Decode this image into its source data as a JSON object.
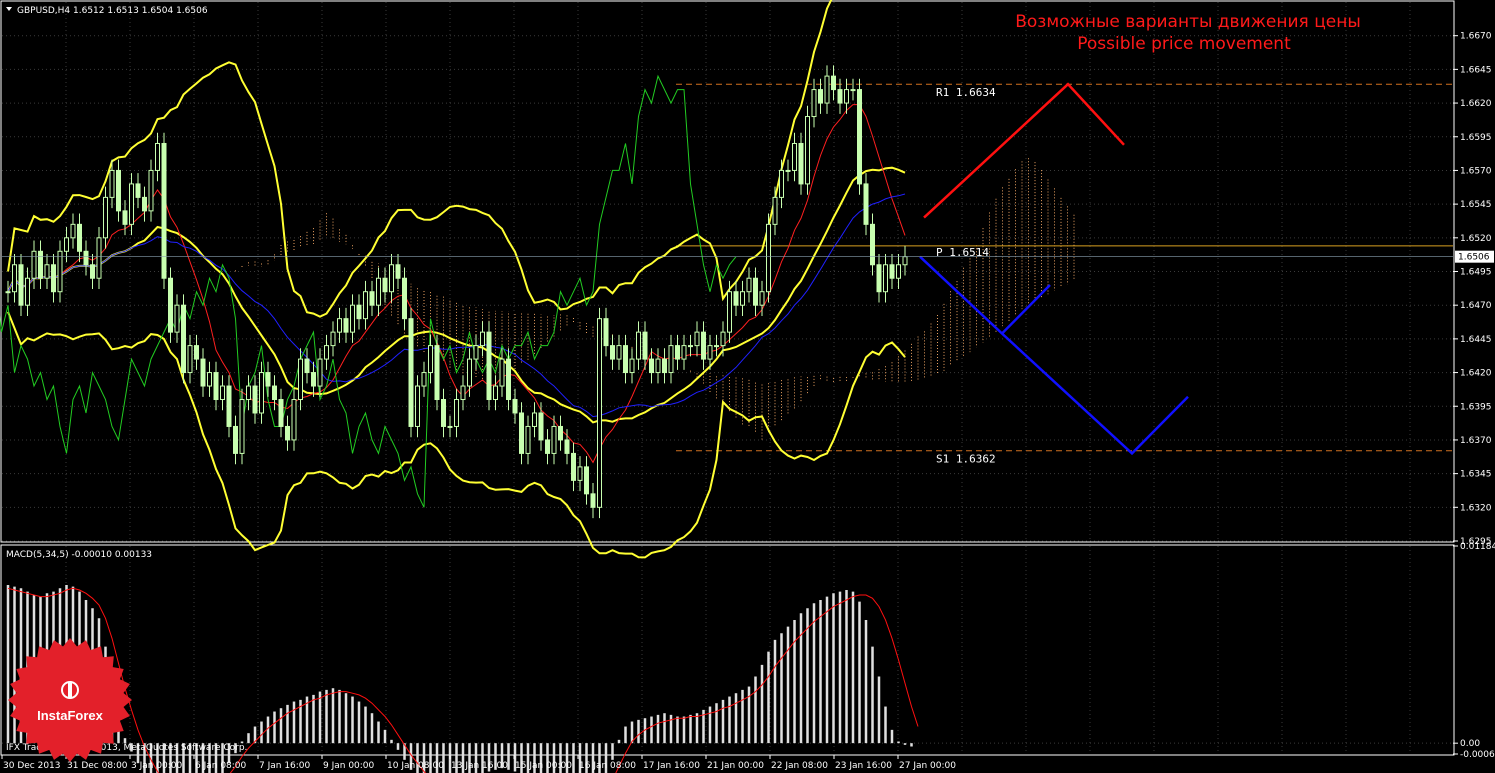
{
  "header": {
    "symbol_line": "GBPUSD,H4  1.6512 1.6513 1.6504 1.6506",
    "macd_line": "MACD(5,34,5) -0.00010 0.00133",
    "footer": "IFX Trader, © 2001-2013, MetaQuotes Software Corp."
  },
  "annotation": {
    "line1": "Возможные варианты движения цены",
    "line2": "Possible price movement"
  },
  "logo": {
    "text": "InstaForex",
    "color": "#e3202a"
  },
  "colors": {
    "background": "#000000",
    "grid": "#3a3a3a",
    "candle": "#c8ffb0",
    "bollinger": "#ffff33",
    "ichimoku_tenkan": "#ff2020",
    "ichimoku_kijun": "#2020ff",
    "chikou": "#22cc22",
    "cloud": "#e8a060",
    "forecast_up": "#ff1010",
    "forecast_down": "#1010ff",
    "level_line": "#d07020",
    "pivot_line": "#d8a020",
    "macd_hist": "#e0e0e0",
    "macd_signal": "#ff1010"
  },
  "chart_data": [
    {
      "type": "candlestick",
      "title": "GBPUSD,H4",
      "ylim": [
        1.6295,
        1.6695
      ],
      "y_ticks": [
        "1.6670",
        "1.6645",
        "1.6620",
        "1.6595",
        "1.6570",
        "1.6545",
        "1.6520",
        "1.6495",
        "1.6470",
        "1.6445",
        "1.6420",
        "1.6395",
        "1.6370",
        "1.6345",
        "1.6320",
        "1.6295"
      ],
      "y_tick_values": [
        1.667,
        1.6645,
        1.662,
        1.6595,
        1.657,
        1.6545,
        1.652,
        1.6495,
        1.647,
        1.6445,
        1.642,
        1.6395,
        1.637,
        1.6345,
        1.632,
        1.6295
      ],
      "current_price": {
        "label": "1.6506",
        "value": 1.6506
      },
      "x_ticks": [
        "30 Dec 2013",
        "31 Dec 08:00",
        "3 Jan 00:00",
        "6 Jan 08:00",
        "7 Jan 16:00",
        "9 Jan 00:00",
        "10 Jan 08:00",
        "13 Jan 16:00",
        "15 Jan 00:00",
        "16 Jan 08:00",
        "17 Jan 16:00",
        "21 Jan 00:00",
        "22 Jan 08:00",
        "23 Jan 16:00",
        "27 Jan 00:00"
      ],
      "levels": [
        {
          "name": "R1",
          "label": "R1  1.6634",
          "value": 1.6634
        },
        {
          "name": "P",
          "label": "P  1.6514",
          "value": 1.6514
        },
        {
          "name": "S1",
          "label": "S1  1.6362",
          "value": 1.6362
        }
      ],
      "closes": [
        1.648,
        1.65,
        1.647,
        1.649,
        1.651,
        1.649,
        1.65,
        1.648,
        1.651,
        1.652,
        1.653,
        1.651,
        1.65,
        1.649,
        1.652,
        1.655,
        1.657,
        1.654,
        1.653,
        1.656,
        1.655,
        1.654,
        1.657,
        1.659,
        1.649,
        1.645,
        1.647,
        1.642,
        1.644,
        1.643,
        1.641,
        1.642,
        1.64,
        1.641,
        1.638,
        1.636,
        1.64,
        1.641,
        1.639,
        1.642,
        1.641,
        1.64,
        1.638,
        1.637,
        1.64,
        1.643,
        1.642,
        1.641,
        1.643,
        1.644,
        1.645,
        1.646,
        1.645,
        1.647,
        1.646,
        1.648,
        1.647,
        1.649,
        1.648,
        1.65,
        1.649,
        1.646,
        1.638,
        1.641,
        1.642,
        1.644,
        1.64,
        1.638,
        1.638,
        1.64,
        1.641,
        1.643,
        1.644,
        1.645,
        1.64,
        1.641,
        1.643,
        1.64,
        1.639,
        1.636,
        1.638,
        1.639,
        1.637,
        1.636,
        1.638,
        1.637,
        1.636,
        1.634,
        1.635,
        1.633,
        1.632,
        1.646,
        1.644,
        1.643,
        1.644,
        1.642,
        1.643,
        1.645,
        1.643,
        1.642,
        1.643,
        1.642,
        1.644,
        1.643,
        1.644,
        1.644,
        1.645,
        1.643,
        1.644,
        1.644,
        1.645,
        1.648,
        1.647,
        1.648,
        1.649,
        1.647,
        1.648,
        1.653,
        1.655,
        1.657,
        1.657,
        1.659,
        1.656,
        1.661,
        1.663,
        1.662,
        1.664,
        1.663,
        1.662,
        1.663,
        1.663,
        1.656,
        1.653,
        1.65,
        1.648,
        1.65,
        1.649,
        1.65,
        1.6506
      ],
      "forecast_up_path": [
        [
          1.6535
        ],
        [
          1.6634
        ],
        [
          1.6589
        ]
      ],
      "forecast_down_path": [
        [
          1.6506
        ],
        [
          1.6449
        ],
        [
          1.636
        ],
        [
          1.6402
        ]
      ],
      "forecast_small_path": [
        [
          1.6449
        ],
        [
          1.6485
        ]
      ]
    },
    {
      "type": "bar",
      "title": "MACD(5,34,5)",
      "values_text": "-0.00010 0.00133",
      "ylim": [
        -0.00065,
        0.01184
      ],
      "y_ticks": [
        "0.01184",
        "0.00",
        "-0.00065"
      ],
      "y_tick_values": [
        0.01184,
        0.0,
        -0.00065
      ],
      "histogram": [
        0.0095,
        0.0094,
        0.0093,
        0.0091,
        0.0089,
        0.0088,
        0.009,
        0.0091,
        0.0093,
        0.0095,
        0.0094,
        0.0091,
        0.0086,
        0.0081,
        0.0075,
        0.0058,
        0.004,
        0.0018,
        0.0003,
        -0.0005,
        -0.0012,
        -0.0018,
        -0.0024,
        -0.0029,
        -0.0033,
        -0.0035,
        -0.0036,
        -0.0034,
        -0.0032,
        -0.003,
        -0.0027,
        -0.0025,
        -0.0022,
        -0.0018,
        -0.0012,
        -0.0006,
        0.0001,
        0.0006,
        0.001,
        0.0013,
        0.0016,
        0.0019,
        0.0021,
        0.0023,
        0.0025,
        0.0026,
        0.0028,
        0.0029,
        0.0031,
        0.0032,
        0.0033,
        0.0032,
        0.003,
        0.0028,
        0.0025,
        0.0022,
        0.0018,
        0.0013,
        0.0008,
        0.0002,
        -0.0004,
        -0.001,
        -0.0016,
        -0.0021,
        -0.0025,
        -0.0028,
        -0.0031,
        -0.0033,
        -0.0032,
        -0.003,
        -0.0027,
        -0.0024,
        -0.0021,
        -0.0019,
        -0.0017,
        -0.0016,
        -0.0015,
        -0.0016,
        -0.0017,
        -0.0019,
        -0.0021,
        -0.0023,
        -0.0025,
        -0.0027,
        -0.003,
        -0.0033,
        -0.0036,
        -0.0039,
        -0.004,
        -0.0041,
        -0.004,
        -0.0032,
        -0.0022,
        -0.001,
        0.0002,
        0.001,
        0.0013,
        0.0014,
        0.0015,
        0.0016,
        0.0017,
        0.0018,
        0.0017,
        0.0016,
        0.0016,
        0.0017,
        0.0018,
        0.002,
        0.0022,
        0.0024,
        0.0026,
        0.0028,
        0.003,
        0.0032,
        0.0034,
        0.004,
        0.0047,
        0.0055,
        0.0062,
        0.0066,
        0.007,
        0.0074,
        0.0078,
        0.0081,
        0.0084,
        0.0086,
        0.0088,
        0.009,
        0.0091,
        0.0092,
        0.0091,
        0.0085,
        0.0074,
        0.0058,
        0.004,
        0.0022,
        0.0008,
        0.0001,
        -0.0001,
        -0.0002
      ],
      "signal": [
        0.0093,
        0.0092,
        0.0091,
        0.009,
        0.0089,
        0.0088,
        0.0088,
        0.0089,
        0.009,
        0.0092,
        0.0093,
        0.0092,
        0.009,
        0.0087,
        0.0083,
        0.0075,
        0.0063,
        0.0048,
        0.0033,
        0.002,
        0.0008,
        -0.0002,
        -0.001,
        -0.0017,
        -0.0023,
        -0.0028,
        -0.0031,
        -0.0032,
        -0.0033,
        -0.0032,
        -0.003,
        -0.0028,
        -0.0026,
        -0.0023,
        -0.0019,
        -0.0014,
        -0.0008,
        -0.0003,
        0.0001,
        0.0005,
        0.0009,
        0.0012,
        0.0015,
        0.0018,
        0.002,
        0.0022,
        0.0024,
        0.0026,
        0.0027,
        0.0029,
        0.003,
        0.0031,
        0.0031,
        0.003,
        0.0029,
        0.0027,
        0.0024,
        0.002,
        0.0016,
        0.0011,
        0.0005,
        -0.0001,
        -0.0007,
        -0.0012,
        -0.0017,
        -0.0021,
        -0.0024,
        -0.0027,
        -0.0028,
        -0.0029,
        -0.0028,
        -0.0027,
        -0.0025,
        -0.0023,
        -0.0021,
        -0.002,
        -0.0019,
        -0.0019,
        -0.0019,
        -0.002,
        -0.0021,
        -0.0022,
        -0.0023,
        -0.0025,
        -0.0027,
        -0.0029,
        -0.0032,
        -0.0034,
        -0.0036,
        -0.0037,
        -0.0037,
        -0.0034,
        -0.0029,
        -0.0022,
        -0.0014,
        -0.0006,
        0.0001,
        0.0005,
        0.0008,
        0.001,
        0.0012,
        0.0013,
        0.0014,
        0.0015,
        0.0015,
        0.0016,
        0.0016,
        0.0017,
        0.0018,
        0.0019,
        0.0021,
        0.0022,
        0.0024,
        0.0026,
        0.0028,
        0.0031,
        0.0035,
        0.004,
        0.0046,
        0.0051,
        0.0056,
        0.0061,
        0.0065,
        0.0069,
        0.0073,
        0.0076,
        0.0079,
        0.0082,
        0.0084,
        0.0086,
        0.0088,
        0.0089,
        0.0089,
        0.0087,
        0.0082,
        0.0074,
        0.0063,
        0.005,
        0.0036,
        0.0022,
        0.001
      ]
    }
  ]
}
